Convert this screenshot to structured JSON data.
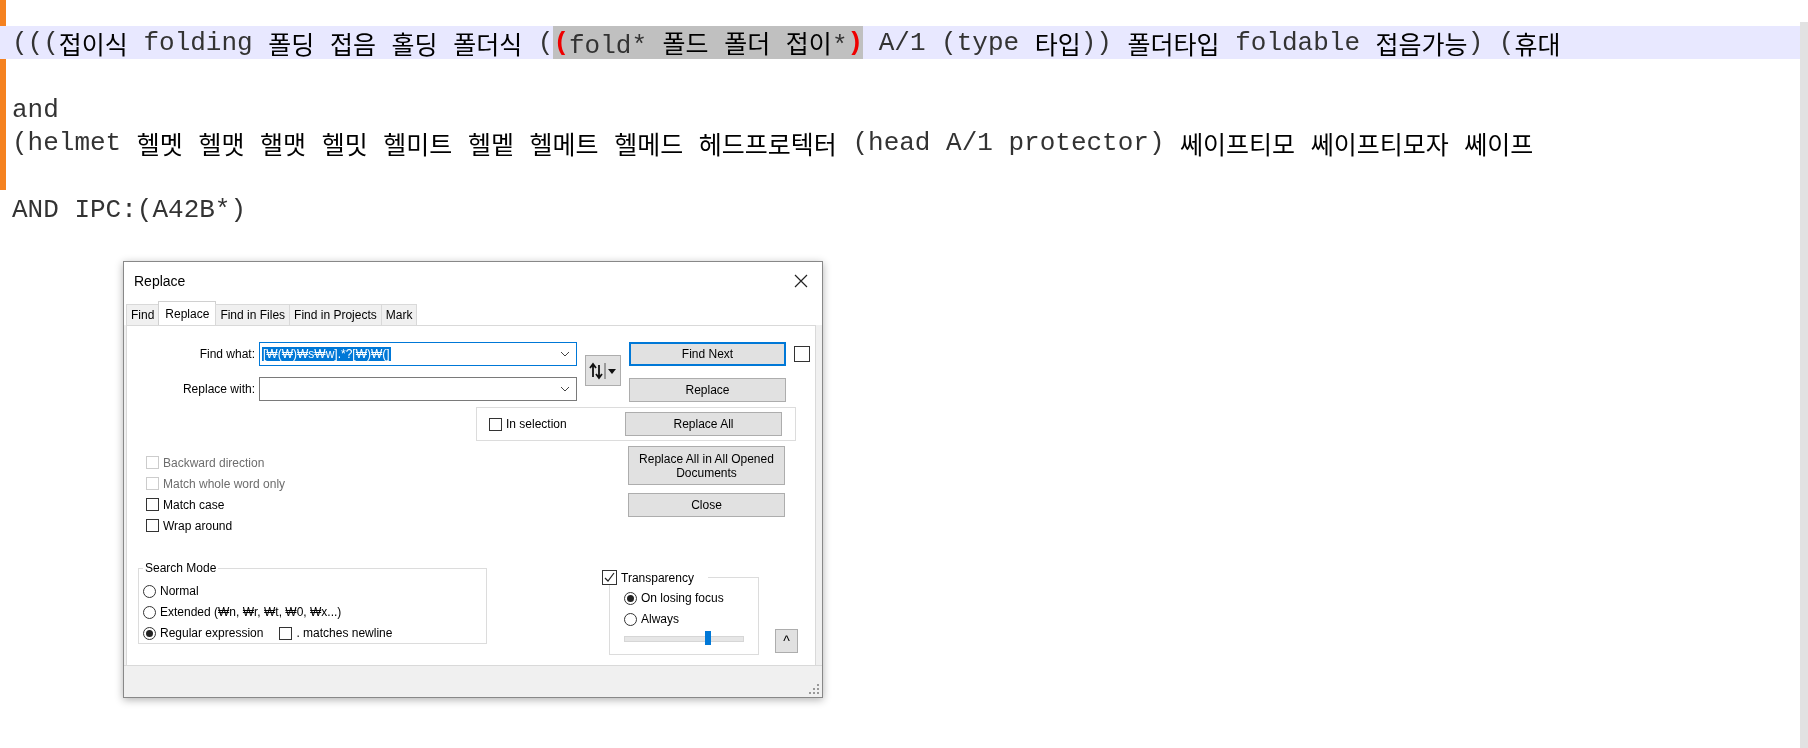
{
  "editor": {
    "paragraphs": [
      [
        {
          "current": true,
          "segments": [
            {
              "kind": "text",
              "text": "(((접이식 folding 폴딩 접음 홀딩 폴더식 ("
            },
            {
              "kind": "match",
              "text": "(fold* 폴드 폴더 접이*)",
              "brace_highlight": true
            },
            {
              "kind": "text",
              "text": " A/1 (type 타입)) 폴더타입 foldable 접음가능) (휴대"
            }
          ]
        }
      ],
      [
        {
          "current": false,
          "segments": [
            {
              "kind": "text",
              "text": "and"
            }
          ]
        },
        {
          "current": false,
          "segments": [
            {
              "kind": "text",
              "text": "(helmet 헬멧 헬맷 핼맷 헬밋 헬미트 헬멭 헬메트 헬메드 헤드프로텍터 (head A/1 protector) 쎄이프티모 쎄이프티모자 쎄이프"
            }
          ]
        }
      ],
      [
        {
          "current": false,
          "segments": [
            {
              "kind": "text",
              "text": "AND IPC:(A42B*)"
            }
          ]
        }
      ]
    ]
  },
  "dialog": {
    "title": "Replace",
    "tabs": [
      {
        "label": "Find",
        "selected": false
      },
      {
        "label": "Replace",
        "selected": true
      },
      {
        "label": "Find in Files",
        "selected": false
      },
      {
        "label": "Find in Projects",
        "selected": false
      },
      {
        "label": "Mark",
        "selected": false
      }
    ],
    "find_what": {
      "label": "Find what:",
      "value": "[₩(₩)₩s₩w].*?[₩)₩(]",
      "selected": true
    },
    "replace_with": {
      "label": "Replace with:"
    },
    "buttons": {
      "find_next": "Find Next",
      "replace": "Replace",
      "replace_all": "Replace All",
      "replace_all_opened": "Replace All in All Opened Documents",
      "close": "Close"
    },
    "find_next_extra_checked": false,
    "in_selection": {
      "label": "In selection",
      "checked": false
    },
    "options": [
      {
        "label": "Backward direction",
        "checked": false,
        "disabled": true
      },
      {
        "label": "Match whole word only",
        "checked": false,
        "disabled": true
      },
      {
        "label": "Match case",
        "checked": false,
        "disabled": false
      },
      {
        "label": "Wrap around",
        "checked": false,
        "disabled": false
      }
    ],
    "search_mode": {
      "title": "Search Mode",
      "modes": [
        {
          "label": "Normal",
          "selected": false
        },
        {
          "label": "Extended (₩n, ₩r, ₩t, ₩0, ₩x...)",
          "selected": false
        },
        {
          "label": "Regular expression",
          "selected": true
        }
      ],
      "dot_newline": {
        "label": ". matches newline",
        "checked": false
      }
    },
    "transparency": {
      "label": "Transparency",
      "checked": true,
      "modes": [
        {
          "label": "On losing focus",
          "selected": true
        },
        {
          "label": "Always",
          "selected": false
        }
      ],
      "level": 0.71
    },
    "collapse_button": "^"
  }
}
